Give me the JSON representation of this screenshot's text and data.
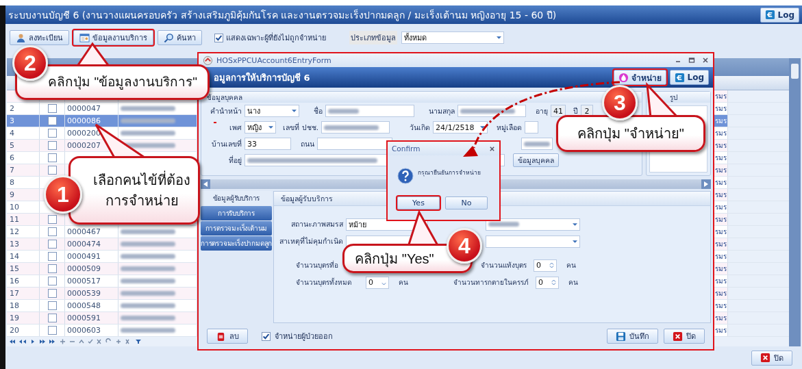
{
  "window": {
    "title": "ระบบงานบัญชี 6 (งานวางแผนครอบครัว สร้างเสริมภูมิคุ้มกันโรค และงานตรวจมะเร็งปากมดลูก / มะเร็งเต้านม หญิงอายุ 15 - 60 ปี)",
    "log_button": "Log",
    "close_button": "ปิด"
  },
  "toolbar": {
    "buttons": [
      {
        "kind": "register",
        "label": "ลงทะเบียน",
        "highlighted": false
      },
      {
        "kind": "service",
        "label": "ข้อมูลงานบริการ",
        "highlighted": true
      },
      {
        "kind": "search",
        "label": "ค้นหา",
        "highlighted": false
      }
    ],
    "filter_checkbox": {
      "label": "แสดงเฉพาะผู้ที่ยังไม่ถูกจำหน่าย",
      "checked": true
    },
    "data_type": {
      "label": "ประเภทข้อมูล",
      "value": "ทั้งหมด"
    }
  },
  "grid": {
    "rows": [
      {
        "selected": false,
        "column_5": "รมร"
      },
      {
        "number": "2",
        "checked": false,
        "hn": "0000047",
        "selected": false,
        "column_5": "รมร"
      },
      {
        "number": "3",
        "checked": false,
        "hn": "0000086",
        "selected": true,
        "column_5": "รมร"
      },
      {
        "number": "4",
        "checked": false,
        "hn": "0000200",
        "selected": false,
        "column_5": "รมร"
      },
      {
        "number": "5",
        "checked": false,
        "hn": "0000207",
        "selected": false,
        "column_5": "รมร"
      },
      {
        "number": "6",
        "checked": false,
        "selected": false,
        "column_5": "รมร"
      },
      {
        "number": "7",
        "checked": false,
        "selected": false,
        "column_5": "รมร"
      },
      {
        "number": "8",
        "selected": false,
        "column_5": "รมร"
      },
      {
        "number": "9",
        "selected": false,
        "column_5": "รมร"
      },
      {
        "number": "10",
        "selected": false,
        "column_5": "รมร"
      },
      {
        "number": "11",
        "checked": false,
        "selected": false,
        "column_5": "รมร"
      },
      {
        "number": "12",
        "checked": false,
        "hn": "0000467",
        "selected": false,
        "column_5": "รมร"
      },
      {
        "number": "13",
        "checked": false,
        "hn": "0000474",
        "selected": false,
        "column_5": "รมร"
      },
      {
        "number": "14",
        "checked": false,
        "hn": "0000491",
        "selected": false,
        "column_5": "รมร"
      },
      {
        "number": "15",
        "checked": false,
        "hn": "0000509",
        "selected": false,
        "column_5": "รมร"
      },
      {
        "number": "16",
        "checked": false,
        "hn": "0000517",
        "selected": false,
        "column_5": "รมร"
      },
      {
        "number": "17",
        "checked": false,
        "hn": "0000539",
        "selected": false,
        "column_5": "รมร"
      },
      {
        "number": "18",
        "checked": false,
        "hn": "0000548",
        "selected": false,
        "column_5": "รมร"
      },
      {
        "number": "19",
        "checked": false,
        "hn": "0000591",
        "selected": false,
        "column_5": "รมร"
      },
      {
        "number": "20",
        "checked": false,
        "hn": "0000603",
        "selected": false,
        "column_5": "รมร"
      }
    ]
  },
  "dialog": {
    "title": "HOSxPPCUAccount6EntryForm",
    "header": "อมูลการให้บริการบัญชี 6",
    "discharge_button": {
      "label": "จำหน่าย",
      "highlighted": true
    },
    "log_button": "Log",
    "person": {
      "group_title": "ข้อมูลบุคคล",
      "prefix_label": "คำนำหน้า",
      "prefix": "นาง",
      "first_name_label": "ชื่อ",
      "last_name_label": "นามสกุล",
      "age_label": "อายุ",
      "age_years": "41",
      "years_label": "ปี",
      "age_months": "2",
      "sex_label": "เพศ",
      "sex": "หญิง",
      "cid_label": "เลขที่ ปชช.",
      "birth_label": "วันเกิด",
      "birth_date": "24/1/2518",
      "blood_label": "หมู่เลือด",
      "house_no_label": "บ้านเลขที่",
      "house_no": "33",
      "road_label": "ถนน",
      "address_label": "ที่อยู่",
      "person_button": "ข้อมูลบุคคล"
    },
    "photo": {
      "group_title": "รูป"
    },
    "nav": [
      {
        "label": "ข้อมูลผู้รับบริการ",
        "selected": true
      },
      {
        "label": "การรับบริการ",
        "selected": false
      },
      {
        "label": "การตรวจมะเร็งเต้านม",
        "selected": false
      },
      {
        "label": "การตรวจมะเร็งปากมดลูก",
        "selected": false
      }
    ],
    "panel": {
      "title": "ข้อมูลผู้รับบริการ",
      "marital_label": "สถานะภาพสมรส",
      "marital": "หม้าย",
      "no_contraception_label": "สาเหตุที่ไม่คุมกำเนิด",
      "living_children_label": "จำนวนบุตรที่อ",
      "abortions_label": "จำนวนแท้งบุตร",
      "abortions": "0",
      "abortions_unit": "คน",
      "total_children_label": "จำนวนบุตรทั้งหมด",
      "total_children": "0",
      "total_children_unit": "คน",
      "stillbirths_label": "จำนวนทารกตายในครรภ์",
      "stillbirths": "0",
      "stillbirths_unit": "คน"
    },
    "footer": {
      "delete_button": "ลบ",
      "discharge_checkbox": {
        "label": "จำหน่ายผู้ป่วยออก",
        "checked": true
      },
      "save_button": "บันทึก",
      "close_button": "ปิด"
    }
  },
  "confirm": {
    "title": "Confirm",
    "message": "กรุณายืนยันการจำหน่าย",
    "yes_button": {
      "label": "Yes",
      "highlighted": true
    },
    "no_button": "No"
  },
  "callouts": [
    {
      "number": "2",
      "lines": [
        "คลิกปุ่ม \"ข้อมูลงานบริการ\""
      ]
    },
    {
      "number": "1",
      "lines": [
        "เลือกคนไข้ที่ต้อง",
        "การจำหน่าย"
      ]
    },
    {
      "number": "3",
      "lines": [
        "คลิกปุ่ม \"จำหน่าย\""
      ]
    },
    {
      "number": "4",
      "lines": [
        "คลิกปุ่ม \"Yes\""
      ]
    }
  ]
}
